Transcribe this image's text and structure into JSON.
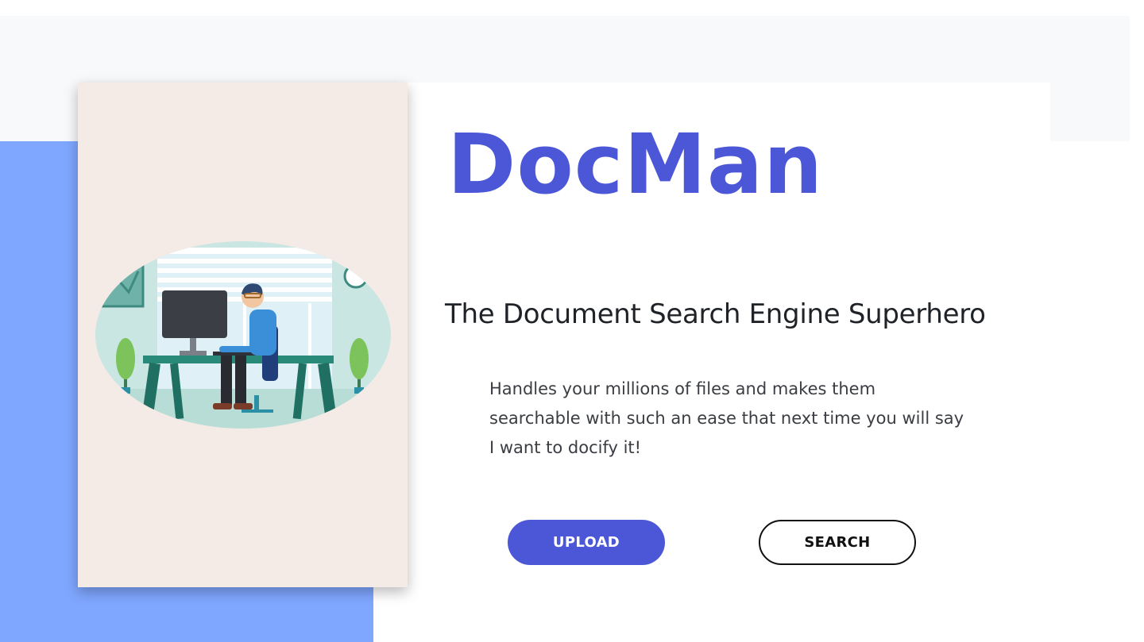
{
  "brand": {
    "title": "DocMan"
  },
  "hero": {
    "tagline": "The Document Search Engine Superhero",
    "description": "Handles your millions of files and makes them searchable with such an ease that next time you will say I want to docify it!"
  },
  "actions": {
    "upload_label": "UPLOAD",
    "search_label": "SEARCH"
  },
  "illustration": {
    "icon": "person-at-desk-illustration"
  },
  "colors": {
    "accent": "#4b57d6",
    "panel_blue": "#7fa7ff",
    "card_beige": "#f4ebe6",
    "band_gray": "#f8f9fb"
  }
}
